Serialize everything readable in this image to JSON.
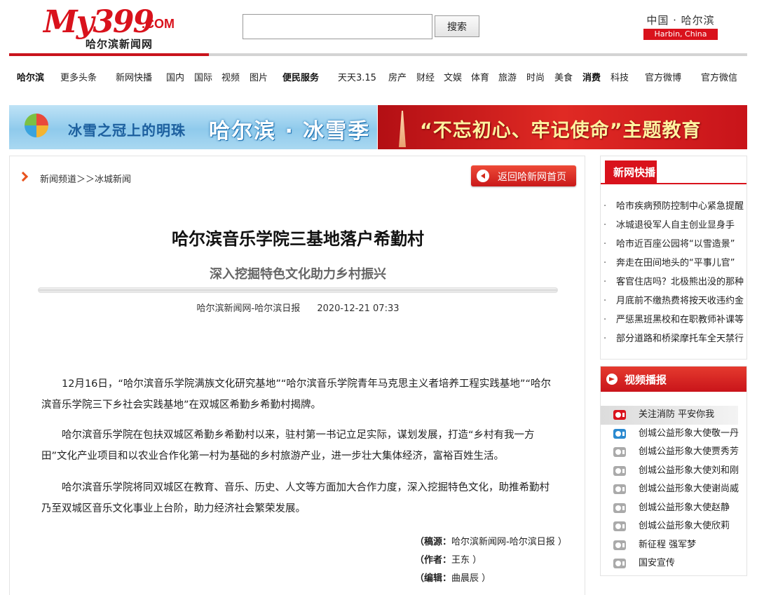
{
  "header": {
    "logo_main": "My399",
    "logo_com": ".COM",
    "logo_sub": "哈尔滨新闻网",
    "search_value": "",
    "search_button": "搜索",
    "city_cn": "中国 · 哈尔滨",
    "city_en": "Harbin, China",
    "colors": {
      "brand_red": "#d9121c"
    }
  },
  "nav": {
    "items": [
      {
        "label": "哈尔滨",
        "bold": true
      },
      {
        "label": "更多头条",
        "bold": false
      },
      {
        "label": "新网快播",
        "bold": false
      },
      {
        "label": "国内",
        "bold": false
      },
      {
        "label": "国际",
        "bold": false
      },
      {
        "label": "视频",
        "bold": false
      },
      {
        "label": "图片",
        "bold": false
      },
      {
        "label": "便民服务",
        "bold": true
      },
      {
        "label": "天天3.15",
        "bold": false
      },
      {
        "label": "房产",
        "bold": false
      },
      {
        "label": "财经",
        "bold": false
      },
      {
        "label": "文娱",
        "bold": false
      },
      {
        "label": "体育",
        "bold": false
      },
      {
        "label": "旅游",
        "bold": false
      },
      {
        "label": "时尚",
        "bold": false
      },
      {
        "label": "美食",
        "bold": false
      },
      {
        "label": "消费",
        "bold": true
      },
      {
        "label": "科技",
        "bold": false
      },
      {
        "label": "官方微博",
        "bold": false
      },
      {
        "label": "官方微信",
        "bold": false
      }
    ]
  },
  "banners": {
    "left_small": "冰雪之冠上的明珠",
    "left_big": "哈尔滨 · 冰雪季",
    "right_text": "“不忘初心、牢记使命”主题教育"
  },
  "article": {
    "breadcrumb": "新闻频道＞＞冰城新闻",
    "back_button": "返回哈新网首页",
    "title": "哈尔滨音乐学院三基地落户希勤村",
    "subtitle": "深入挖掘特色文化助力乡村振兴",
    "source": "哈尔滨新闻网-哈尔滨日报",
    "datetime": "2020-12-21 07:33",
    "paragraphs": [
      "12月16日，“哈尔滨音乐学院满族文化研究基地”“哈尔滨音乐学院青年马克思主义者培养工程实践基地”“哈尔滨音乐学院三下乡社会实践基地”在双城区希勤乡希勤村揭牌。",
      "哈尔滨音乐学院在包扶双城区希勤乡希勤村以来，驻村第一书记立足实际，谋划发展，打造“乡村有我一方田”文化产业项目和以农业合作化第一村为基础的乡村旅游产业，进一步壮大集体经济，富裕百姓生活。",
      "哈尔滨音乐学院将同双城区在教育、音乐、历史、人文等方面加大合作力度，深入挖掘特色文化，助推希勤村乃至双城区音乐文化事业上台阶，助力经济社会繁荣发展。"
    ],
    "credits": [
      {
        "key": "（稿源：",
        "value": "哈尔滨新闻网-哈尔滨日报 ）"
      },
      {
        "key": "（作者：",
        "value": "王东 ）"
      },
      {
        "key": "（编辑：",
        "value": "曲晨辰 ）"
      }
    ]
  },
  "sidebar": {
    "news_title": "新网快播",
    "news_items": [
      "哈市疾病预防控制中心紧急提醒",
      "冰城退役军人自主创业显身手",
      "哈市近百座公园将“以雪造景”",
      "奔走在田间地头的“平事儿官”",
      "客官住店吗？北极熊出没的那种",
      "月底前不缴热费将按天收违约金",
      "严惩黑班黑校和在职教师补课等",
      "部分道路和桥梁摩托车全天禁行"
    ],
    "video_title": "视频播报",
    "video_items": [
      {
        "label": "关注消防 平安你我",
        "icon": "red"
      },
      {
        "label": "创城公益形象大使敬一丹",
        "icon": "blue"
      },
      {
        "label": "创城公益形象大使贾秀芳",
        "icon": "gray"
      },
      {
        "label": "创城公益形象大使刘和刚",
        "icon": "gray"
      },
      {
        "label": "创城公益形象大使谢尚威",
        "icon": "gray"
      },
      {
        "label": "创城公益形象大使赵静",
        "icon": "gray"
      },
      {
        "label": "创城公益形象大使欣莉",
        "icon": "gray"
      },
      {
        "label": "新征程 强军梦",
        "icon": "gray"
      },
      {
        "label": "国安宣传",
        "icon": "gray"
      }
    ]
  }
}
